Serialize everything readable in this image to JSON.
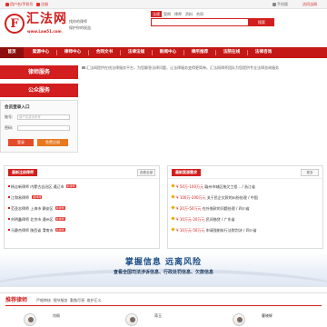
{
  "topbar": {
    "login_phone": "用户名/手机号",
    "register": "注册",
    "mobile_version": "手机版",
    "visit": "访问法网"
  },
  "header": {
    "logo_char": "F",
    "logo_name": "汇法网",
    "logo_url": "www.Law51.com",
    "slogan_1": "找你的律师",
    "slogan_2": "保护你的权益",
    "search_tabs": [
      "法规",
      "案例",
      "律师",
      "资料",
      "合同"
    ],
    "search_button": "搜索"
  },
  "nav": {
    "items": [
      "首页",
      "案源中心",
      "律师中心",
      "合同文书",
      "法律法规",
      "新闻中心",
      "律所推荐",
      "法院在线",
      "法律咨询"
    ]
  },
  "left": {
    "lawyer_service": "律师服务",
    "public_service": "公众服务",
    "login_title": "会员登录入口",
    "username_label": "账号:",
    "username_placeholder": "用户名或手机号",
    "password_label": "密码:",
    "login_button": "登录",
    "register_button": "免费注册"
  },
  "notice": "汇法网提供在线法律服务平台，为您解答法律问题，让法律服务变得更简单。汇法网律师团队为您提供专业法律咨询服务",
  "lawyers_box": {
    "title": "最新注册律师",
    "more": "查看全部",
    "rows": [
      {
        "name": "杨志新律师",
        "location": "内蒙古自治区 通辽市",
        "badge": "新律师"
      },
      {
        "name": "江和易律师",
        "location": "",
        "badge": "新律师"
      },
      {
        "name": "范圣忠律师",
        "location": "上海市 静安区",
        "badge": "新律师"
      },
      {
        "name": "刘明鑫律师",
        "location": "北京市 通州区",
        "badge": "新律师"
      },
      {
        "name": "马静杰律师",
        "location": "陕西省 渭南市",
        "badge": "新律师"
      }
    ]
  },
  "cases_box": {
    "title": "最新案源需求",
    "more": "更多",
    "rows": [
      {
        "amount": "¥ 50万-100万元",
        "text": "赣州市城区拖欠工程...",
        "place": "/ 浙江省"
      },
      {
        "amount": "¥ 100万-200万元",
        "text": "关于民企欠款的纠纷处理",
        "place": "/ 中国"
      },
      {
        "amount": "¥ 20万-50万元",
        "text": "在外借款的问题处理",
        "place": "/ 四川省"
      },
      {
        "amount": "¥ 10万元-20万元",
        "text": "民间借贷",
        "place": "/ 广东省"
      },
      {
        "amount": "¥ 10万元-50万元",
        "text": "申请强制执行法院判决",
        "place": "/ 四川省"
      }
    ]
  },
  "banner": {
    "line1": "掌握信息 远离风险",
    "line2": "查看全国司法涉诉信息、行政处罚信息、欠款信息"
  },
  "recommend": {
    "title": "推荐律师",
    "tags": [
      "严格审核",
      "细节服务",
      "勤勉尽责",
      "维护正义"
    ],
    "lawyers": [
      "肖佩",
      "蒋玉",
      "曹晓辉"
    ]
  }
}
